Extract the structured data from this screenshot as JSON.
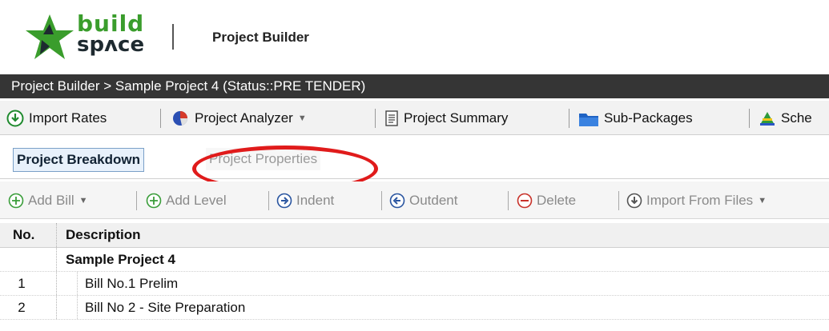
{
  "logo": {
    "word1": "build",
    "word2": "spʌce"
  },
  "app": {
    "title": "Project Builder"
  },
  "breadcrumb": {
    "text": "Project Builder > Sample Project 4 (Status::PRE TENDER)"
  },
  "toolbar": {
    "items": [
      {
        "label": "Import Rates",
        "icon": "download-circle-icon"
      },
      {
        "label": "Project Analyzer",
        "icon": "pie-chart-icon",
        "dropdown": true
      },
      {
        "label": "Project Summary",
        "icon": "document-list-icon"
      },
      {
        "label": "Sub-Packages",
        "icon": "folder-icon"
      },
      {
        "label": "Sche",
        "icon": "schedule-pyramid-icon"
      }
    ]
  },
  "tabs": [
    {
      "label": "Project Breakdown",
      "active": true
    },
    {
      "label": "Project Properties",
      "active": false,
      "highlighted": true
    }
  ],
  "toolbar2": {
    "items": [
      {
        "label": "Add Bill",
        "icon": "plus-circle-icon",
        "dropdown": true
      },
      {
        "label": "Add Level",
        "icon": "plus-circle-icon"
      },
      {
        "label": "Indent",
        "icon": "arrow-right-circle-icon"
      },
      {
        "label": "Outdent",
        "icon": "arrow-left-circle-icon"
      },
      {
        "label": "Delete",
        "icon": "minus-circle-icon"
      },
      {
        "label": "Import From Files",
        "icon": "download-circle-icon",
        "dropdown": true
      }
    ]
  },
  "grid": {
    "columns": [
      "No.",
      "Description"
    ],
    "rows": [
      {
        "no": "",
        "desc": "Sample Project 4"
      },
      {
        "no": "1",
        "desc": "Bill No.1 Prelim"
      },
      {
        "no": "2",
        "desc": "Bill No 2 - Site Preparation"
      }
    ]
  },
  "colors": {
    "breadcrumb_bg": "#353535",
    "highlight": "#e01b1b",
    "logo_green": "#3a9d2c"
  }
}
